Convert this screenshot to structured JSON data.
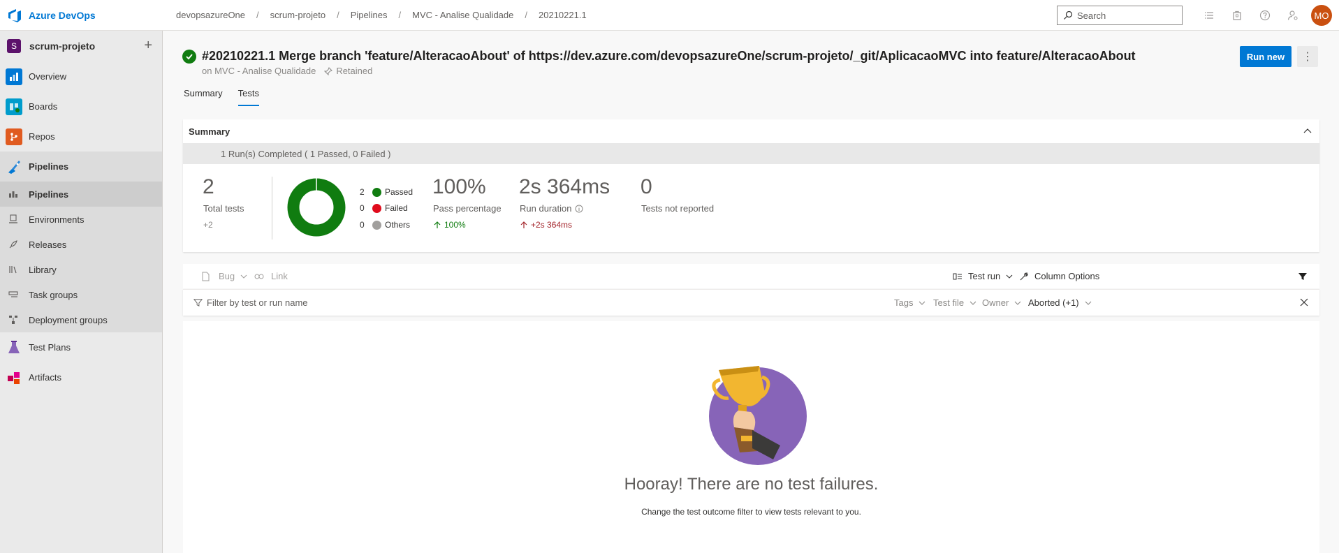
{
  "app": {
    "name": "Azure DevOps"
  },
  "breadcrumb": [
    "devopsazureOne",
    "scrum-projeto",
    "Pipelines",
    "MVC - Analise Qualidade",
    "20210221.1"
  ],
  "topbar": {
    "search_placeholder": "Search",
    "avatar_initials": "MO"
  },
  "sidebar": {
    "project_initial": "S",
    "project_name": "scrum-projeto",
    "items": {
      "overview": "Overview",
      "boards": "Boards",
      "repos": "Repos",
      "pipelines_group": "Pipelines",
      "pipelines": "Pipelines",
      "environments": "Environments",
      "releases": "Releases",
      "library": "Library",
      "task_groups": "Task groups",
      "deployment_groups": "Deployment groups",
      "test_plans": "Test Plans",
      "artifacts": "Artifacts"
    }
  },
  "run": {
    "title": "#20210221.1 Merge branch 'feature/AlteracaoAbout' of https://dev.azure.com/devopsazureOne/scrum-projeto/_git/AplicacaoMVC into feature/AlteracaoAbout",
    "on_pipeline": "on MVC - Analise Qualidade",
    "retained": "Retained",
    "run_new_label": "Run new"
  },
  "tabs": {
    "summary": "Summary",
    "tests": "Tests"
  },
  "summary_card": {
    "heading": "Summary",
    "runs_completed": "1 Run(s) Completed ( 1 Passed, 0 Failed )",
    "total_tests": "2",
    "total_tests_label": "Total tests",
    "total_tests_delta": "+2",
    "legend": {
      "passed_count": "2",
      "passed_label": "Passed",
      "failed_count": "0",
      "failed_label": "Failed",
      "others_count": "0",
      "others_label": "Others"
    },
    "pass_percentage": "100%",
    "pass_percentage_label": "Pass percentage",
    "pass_percentage_delta": "100%",
    "run_duration": "2s 364ms",
    "run_duration_label": "Run duration",
    "run_duration_delta": "+2s 364ms",
    "not_reported": "0",
    "not_reported_label": "Tests not reported",
    "donut": {
      "passed": 2,
      "failed": 0,
      "others": 0
    },
    "colors": {
      "passed": "#107c10",
      "failed": "#e00b1c",
      "others": "#a19f9d"
    }
  },
  "toolbar": {
    "bug": "Bug",
    "link": "Link",
    "test_run": "Test run",
    "column_options": "Column Options"
  },
  "filterbar": {
    "placeholder": "Filter by test or run name",
    "tags": "Tags",
    "test_file": "Test file",
    "owner": "Owner",
    "outcome": "Aborted (+1)"
  },
  "empty_state": {
    "title": "Hooray! There are no test failures.",
    "subtitle": "Change the test outcome filter to view tests relevant to you."
  },
  "colors": {
    "accent": "#0078d4",
    "success": "#107c10",
    "trophy_bg": "#8764b8"
  }
}
